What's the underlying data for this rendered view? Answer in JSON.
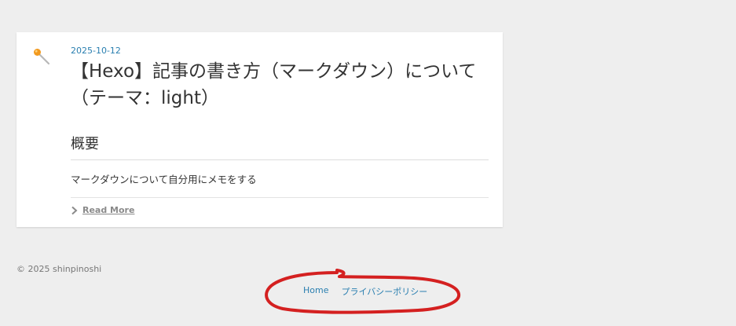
{
  "post": {
    "date": "2025-10-12",
    "title": "【Hexo】記事の書き方（マークダウン）について（テーマ：light）",
    "section_heading": "概要",
    "excerpt": "マークダウンについて自分用にメモをする",
    "read_more_label": "Read More",
    "pin_icon": "pushpin-icon",
    "read_more_icon": "chevron-right-icon"
  },
  "footer": {
    "copyright": "© 2025 shinpinoshi",
    "links": [
      {
        "label": "Home"
      },
      {
        "label": "プライバシーポリシー"
      }
    ]
  },
  "colors": {
    "background": "#eeeeee",
    "card": "#ffffff",
    "link": "#2a7fb0",
    "annotation": "#d42020"
  }
}
